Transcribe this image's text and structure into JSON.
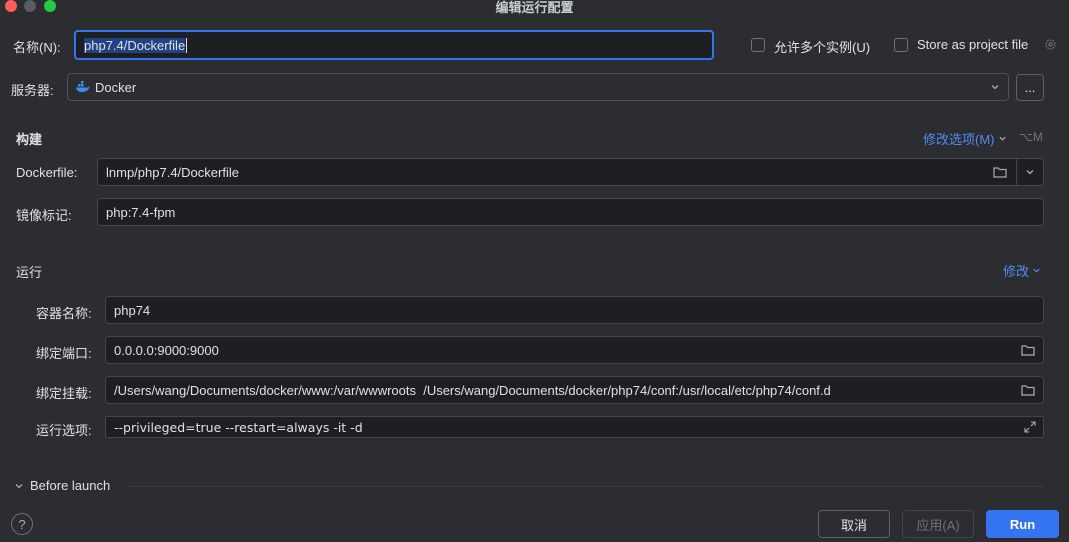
{
  "window": {
    "title": "编辑运行配置"
  },
  "name": {
    "label": "名称(N):",
    "value": "php7.4/Dockerfile"
  },
  "allow_multiple": {
    "label": "允许多个实例(U)",
    "checked": false
  },
  "store_project": {
    "label": "Store as project file",
    "checked": false
  },
  "server": {
    "label": "服务器:",
    "value": "Docker",
    "more_label": "..."
  },
  "build": {
    "heading": "构建",
    "modify_options": "修改选项(M)",
    "shortcut": "⌥M",
    "dockerfile_label": "Dockerfile:",
    "dockerfile_value": "lnmp/php7.4/Dockerfile",
    "image_tag_label": "镜像标记:",
    "image_tag_value": "php:7.4-fpm"
  },
  "run": {
    "heading": "运行",
    "modify": "修改",
    "container_name_label": "容器名称:",
    "container_name_value": "php74",
    "bind_ports_label": "绑定端口:",
    "bind_ports_value": "0.0.0.0:9000:9000",
    "bind_mounts_label": "绑定挂载:",
    "bind_mounts_value": "/Users/wang/Documents/docker/www:/var/wwwroots  /Users/wang/Documents/docker/php74/conf:/usr/local/etc/php74/conf.d",
    "run_options_label": "运行选项:",
    "run_options_value": "--privileged=true --restart=always -it -d"
  },
  "before_launch": {
    "label": "Before launch"
  },
  "buttons": {
    "cancel": "取消",
    "apply": "应用(A)",
    "run": "Run",
    "help": "?"
  },
  "colors": {
    "accent": "#3574f0",
    "link": "#548af7",
    "background": "#2b2d30",
    "field": "#1e1f22"
  }
}
